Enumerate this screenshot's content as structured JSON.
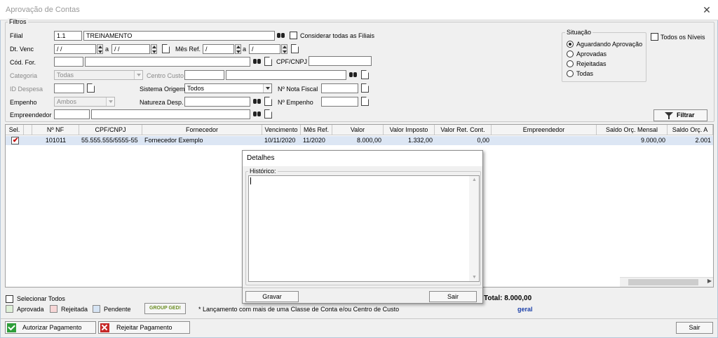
{
  "window": {
    "title": "Aprovação de Contas",
    "close_glyph": "✕"
  },
  "filtros": {
    "legend": "Filtros",
    "filial": {
      "label": "Filial",
      "code": "1.1",
      "name": "TREINAMENTO",
      "consider_all_label": "Considerar todas as Filiais"
    },
    "dt_venc": {
      "label": "Dt. Venc",
      "from": " /  /",
      "sep": "a",
      "to": " /  /"
    },
    "mes_ref": {
      "label": "Mês Ref.",
      "from": " /",
      "sep": "a",
      "to": " /"
    },
    "cod_for": {
      "label": "Cód. For.",
      "code": "",
      "name": ""
    },
    "cpf_cnpj": {
      "label": "CPF/CNPJ",
      "value": ""
    },
    "categoria": {
      "label": "Categoria",
      "value": "Todas"
    },
    "centro_custo": {
      "label": "Centro Custo",
      "code": "",
      "name": ""
    },
    "id_despesa": {
      "label": "ID Despesa",
      "value": ""
    },
    "sistema_origem": {
      "label": "Sistema Origem",
      "value": "Todos"
    },
    "nota_fiscal": {
      "label": "Nº Nota Fiscal",
      "value": ""
    },
    "empenho": {
      "label": "Empenho",
      "value": "Ambos"
    },
    "natureza_desp": {
      "label": "Natureza Desp.",
      "value": ""
    },
    "num_empenho": {
      "label": "Nº Empenho",
      "value": ""
    },
    "empreendedor": {
      "label": "Empreendedor",
      "code": "",
      "name": ""
    },
    "filtrar_label": "Filtrar"
  },
  "situacao": {
    "legend": "Situação",
    "options": [
      "Aguardando Aprovação",
      "Aprovadas",
      "Rejeitadas",
      "Todas"
    ],
    "selected": "Aguardando Aprovação",
    "todos_niveis_label": "Todos os Níveis"
  },
  "grid": {
    "columns": [
      "Sel.",
      "",
      "Nº NF",
      "CPF/CNPJ",
      "Fornecedor",
      "Vencimento",
      "Mês Ref.",
      "Valor",
      "Valor Imposto",
      "Valor Ret. Cont.",
      "Empreendedor",
      "Saldo Orç. Mensal",
      "Saldo Orç. A"
    ],
    "rows": [
      {
        "nf": "101011",
        "cpf_cnpj": "55.555.555/5555-55",
        "fornecedor": "Fornecedor Exemplo",
        "vencimento": "10/11/2020",
        "mes_ref": "11/2020",
        "valor": "8.000,00",
        "valor_imposto": "1.332,00",
        "valor_ret_cont": "0,00",
        "empreendedor": "",
        "saldo_mensal": "9.000,00",
        "saldo_a": "2.001"
      }
    ]
  },
  "detalhes": {
    "title": "Detalhes",
    "historico_legend": "Histórico:",
    "historico_text": "",
    "gravar_label": "Gravar",
    "sair_label": "Sair"
  },
  "footer": {
    "selecionar_todos": "Selecionar Todos",
    "legend_aprovada": "Aprovada",
    "legend_rejeitada": "Rejeitada",
    "legend_pendente": "Pendente",
    "group_ged": "GROUP GED!",
    "note": "* Lançamento com mais de uma Classe de Conta e/ou Centro de Custo",
    "total": "Total: 8.000,00",
    "total_sub": "geral",
    "colors": {
      "aprovada": "#dff0d8",
      "rejeitada": "#f7d6d6",
      "pendente": "#d6e4f4",
      "total_sub": "#1a3fa8"
    }
  },
  "actions": {
    "autorizar_label": "Autorizar Pagamento",
    "rejeitar_label": "Rejeitar Pagamento",
    "sair_label": "Sair"
  }
}
